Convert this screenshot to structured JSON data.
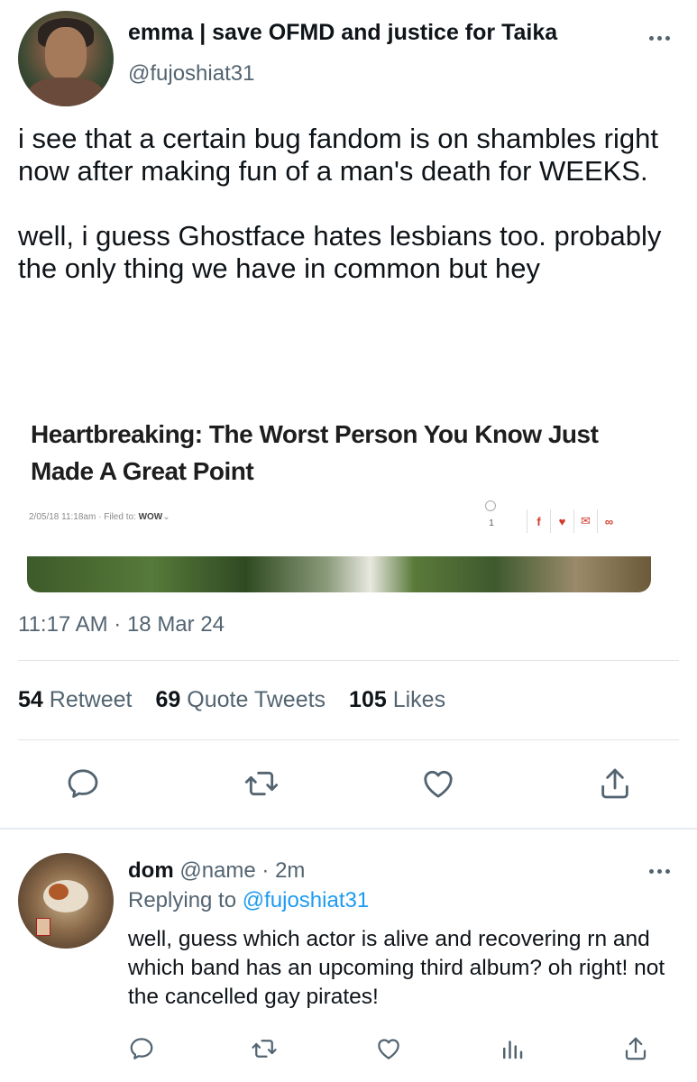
{
  "tweet": {
    "author": {
      "display_name": "emma | save OFMD and justice for Taika",
      "handle": "@fujoshiat31"
    },
    "text_paragraphs": [
      "i see that a certain bug fandom is on shambles right now after making fun of a man's death for WEEKS.",
      "well, i guess Ghostface hates lesbians too. probably the only thing we have in common but hey"
    ],
    "media": {
      "headline": "Heartbreaking: The Worst Person You Know Just Made A Great Point",
      "meta_date": "2/05/18 11:18am",
      "meta_separator": "·",
      "meta_filed_label": "Filed to:",
      "meta_filed_value": "WOW",
      "comment_count": "1",
      "share_icons": [
        "facebook-icon",
        "twitter-icon",
        "email-icon",
        "link-icon"
      ]
    },
    "timestamp": "11:17 AM · 18 Mar 24",
    "stats": {
      "retweets_count": "54",
      "retweets_label": "Retweet",
      "quotes_count": "69",
      "quotes_label": "Quote Tweets",
      "likes_count": "105",
      "likes_label": "Likes"
    },
    "actions": [
      "reply-icon",
      "retweet-icon",
      "like-icon",
      "share-icon"
    ]
  },
  "reply": {
    "display_name": "dom",
    "handle": "@name",
    "time": "· 2m",
    "replying_prefix": "Replying to",
    "replying_to": "@fujoshiat31",
    "text": "well, guess which actor is alive and recovering rn and which band has an upcoming third album? oh right! not the cancelled gay pirates!",
    "actions": [
      "reply-icon",
      "retweet-icon",
      "like-icon",
      "analytics-icon",
      "share-icon"
    ]
  },
  "colors": {
    "text_primary": "#0f1419",
    "text_secondary": "#536471",
    "link": "#1d9bf0",
    "divider": "#e1e4e7"
  }
}
